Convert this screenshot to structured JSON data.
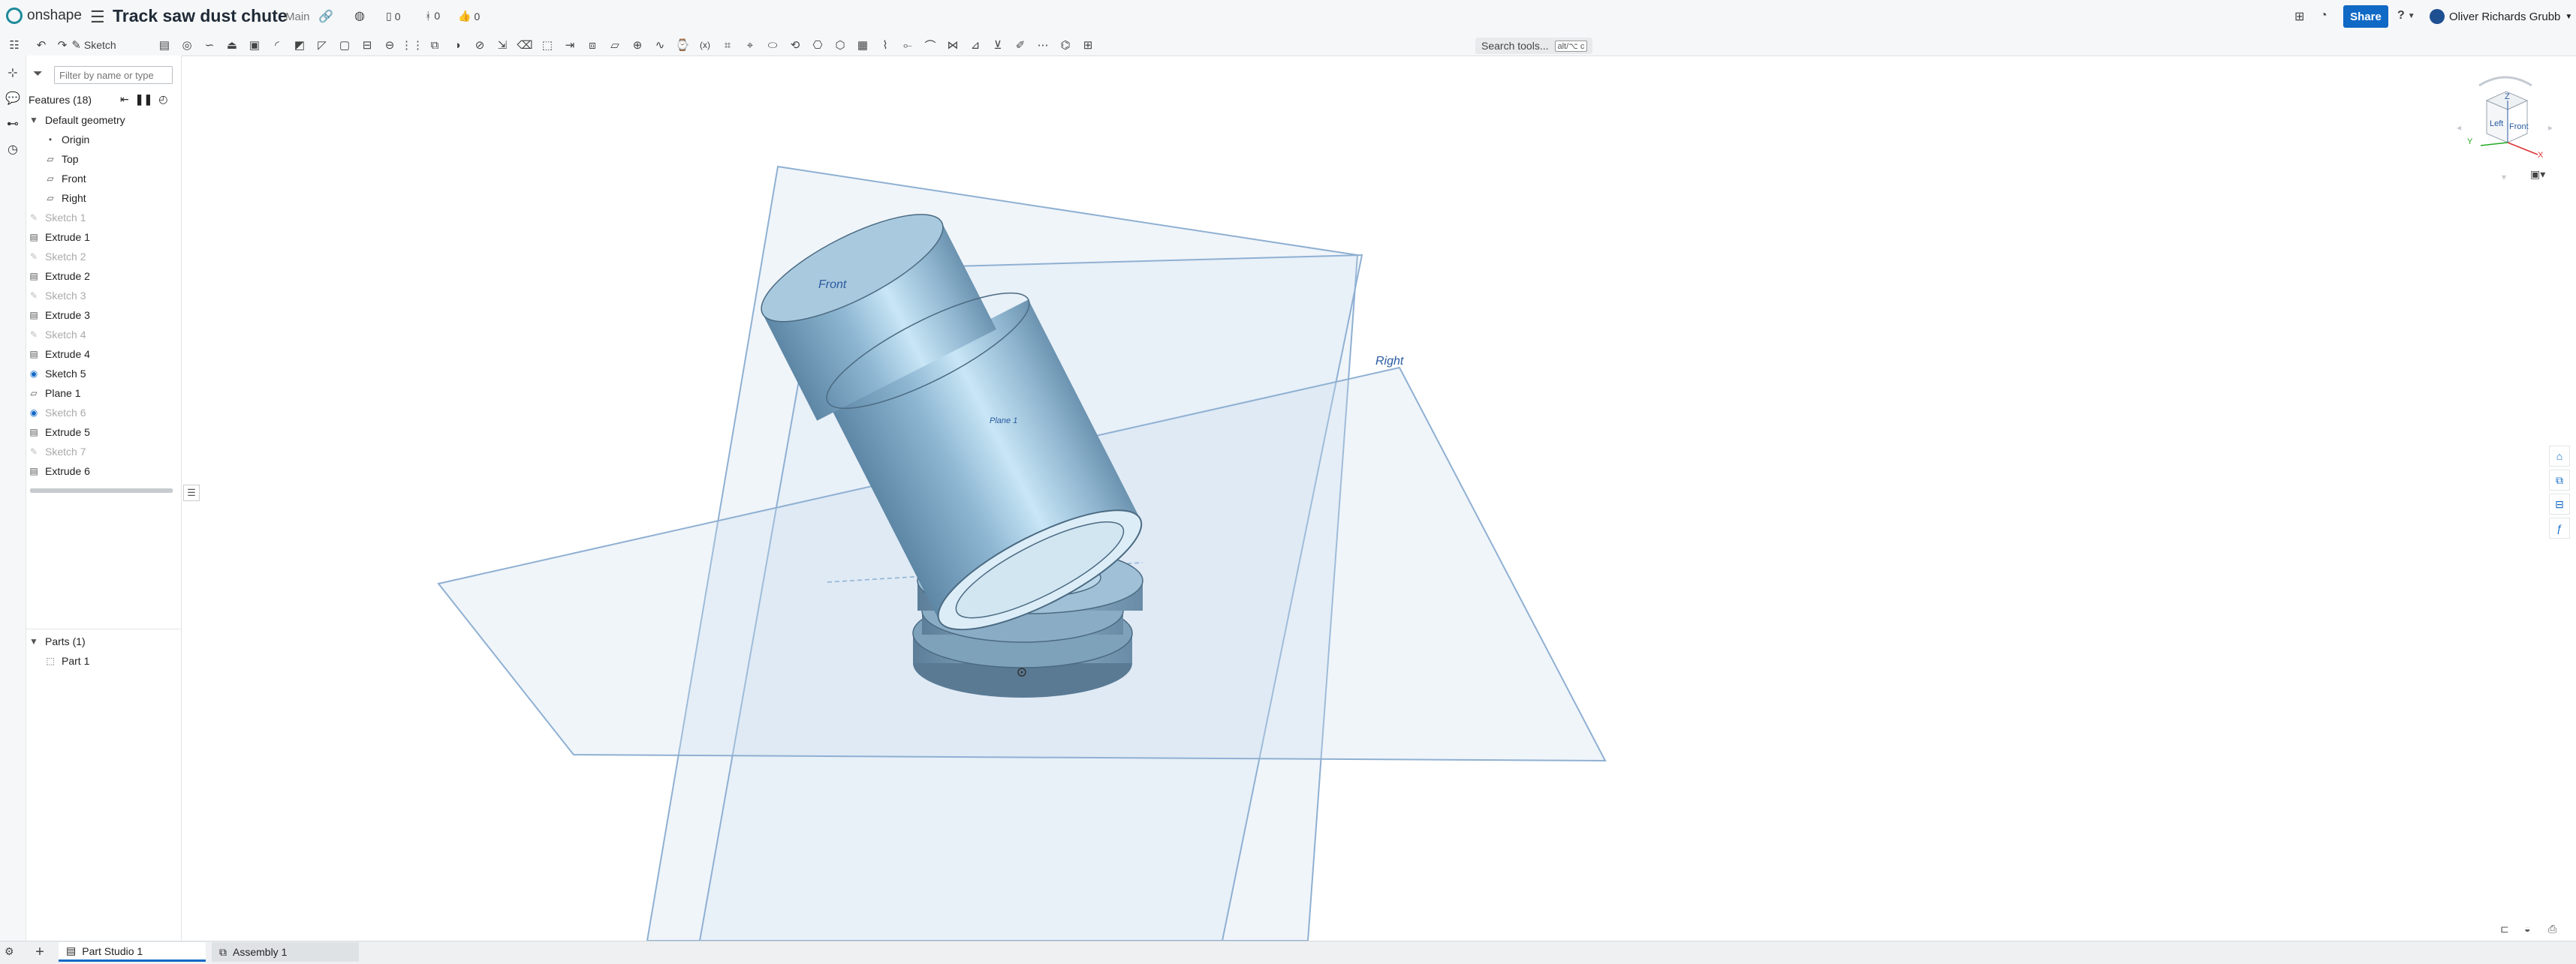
{
  "app": {
    "logo_text": "onshape",
    "document_title": "Track saw dust chute",
    "branch": "Main",
    "counters": {
      "versions": "0",
      "branches": "0",
      "likes": "0"
    },
    "share_label": "Share",
    "help_label": "?",
    "user_name": "Oliver Richards Grubb"
  },
  "toolbar": {
    "sketch_label": "Sketch",
    "variable_label": "(x)",
    "search_tools_label": "Search tools...",
    "search_tools_shortcut": "alt/⌥ c"
  },
  "feature_panel": {
    "filter_placeholder": "Filter by name or type",
    "header": "Features (18)",
    "default_geometry": "Default geometry",
    "default_items": [
      "Origin",
      "Top",
      "Front",
      "Right"
    ],
    "features": [
      {
        "label": "Sketch 1",
        "type": "sketch",
        "suppressed": true
      },
      {
        "label": "Extrude 1",
        "type": "extrude",
        "suppressed": false
      },
      {
        "label": "Sketch 2",
        "type": "sketch",
        "suppressed": true
      },
      {
        "label": "Extrude 2",
        "type": "extrude",
        "suppressed": false
      },
      {
        "label": "Sketch 3",
        "type": "sketch",
        "suppressed": true
      },
      {
        "label": "Extrude 3",
        "type": "extrude",
        "suppressed": false
      },
      {
        "label": "Sketch 4",
        "type": "sketch",
        "suppressed": true
      },
      {
        "label": "Extrude 4",
        "type": "extrude",
        "suppressed": false
      },
      {
        "label": "Sketch 5",
        "type": "sketch",
        "suppressed": false
      },
      {
        "label": "Plane 1",
        "type": "plane",
        "suppressed": false
      },
      {
        "label": "Sketch 6",
        "type": "sketch",
        "suppressed": true
      },
      {
        "label": "Extrude 5",
        "type": "extrude",
        "suppressed": false
      },
      {
        "label": "Sketch 7",
        "type": "sketch",
        "suppressed": true
      },
      {
        "label": "Extrude 6",
        "type": "extrude",
        "suppressed": false
      }
    ],
    "parts_header": "Parts (1)",
    "parts": [
      "Part 1"
    ]
  },
  "viewport": {
    "plane_labels": {
      "front": "Front",
      "right": "Right",
      "plane1": "Plane 1"
    },
    "part_color": "#8fb3cc",
    "plane_color": "#c9dcec"
  },
  "viewcube": {
    "left": "Left",
    "front": "Front",
    "z": "Z",
    "x": "X",
    "y": "Y"
  },
  "tabs": [
    {
      "label": "Part Studio 1",
      "active": true
    },
    {
      "label": "Assembly 1",
      "active": false
    }
  ]
}
